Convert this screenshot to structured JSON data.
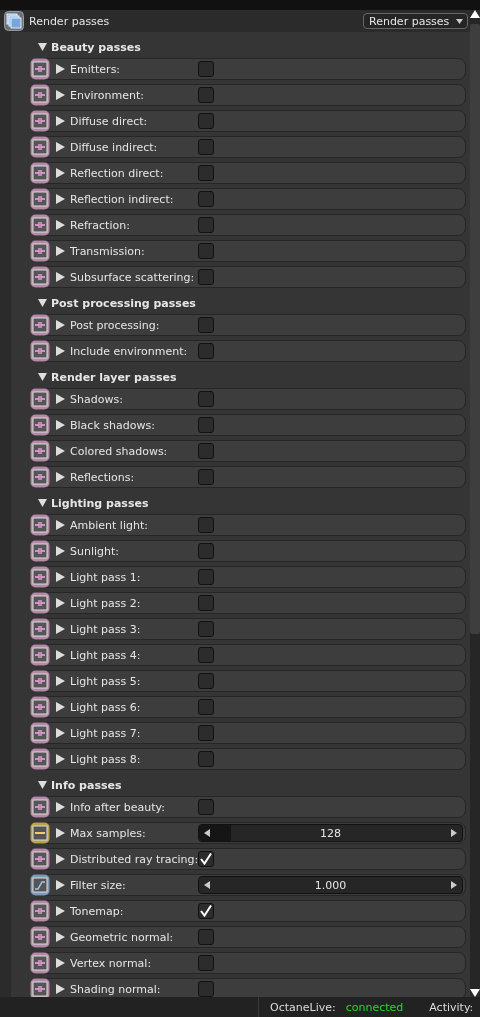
{
  "header": {
    "title": "Render passes",
    "dropdown": "Render passes"
  },
  "sections": [
    {
      "title": "Beauty passes",
      "expanded": true,
      "rows": [
        {
          "kind": "bool",
          "label": "Emitters:",
          "checked": false
        },
        {
          "kind": "bool",
          "label": "Environment:",
          "checked": false
        },
        {
          "kind": "bool",
          "label": "Diffuse direct:",
          "checked": false
        },
        {
          "kind": "bool",
          "label": "Diffuse indirect:",
          "checked": false
        },
        {
          "kind": "bool",
          "label": "Reflection direct:",
          "checked": false
        },
        {
          "kind": "bool",
          "label": "Reflection indirect:",
          "checked": false
        },
        {
          "kind": "bool",
          "label": "Refraction:",
          "checked": false
        },
        {
          "kind": "bool",
          "label": "Transmission:",
          "checked": false
        },
        {
          "kind": "bool",
          "label": "Subsurface scattering:",
          "checked": false
        }
      ]
    },
    {
      "title": "Post processing passes",
      "expanded": true,
      "rows": [
        {
          "kind": "bool",
          "label": "Post processing:",
          "checked": false
        },
        {
          "kind": "bool",
          "label": "Include environment:",
          "checked": false
        }
      ]
    },
    {
      "title": "Render layer passes",
      "expanded": true,
      "rows": [
        {
          "kind": "bool",
          "label": "Shadows:",
          "checked": false
        },
        {
          "kind": "bool",
          "label": "Black shadows:",
          "checked": false
        },
        {
          "kind": "bool",
          "label": "Colored shadows:",
          "checked": false
        },
        {
          "kind": "bool",
          "label": "Reflections:",
          "checked": false
        }
      ]
    },
    {
      "title": "Lighting passes",
      "expanded": true,
      "rows": [
        {
          "kind": "bool",
          "label": "Ambient light:",
          "checked": false
        },
        {
          "kind": "bool",
          "label": "Sunlight:",
          "checked": false
        },
        {
          "kind": "bool",
          "label": "Light pass 1:",
          "checked": false
        },
        {
          "kind": "bool",
          "label": "Light pass 2:",
          "checked": false
        },
        {
          "kind": "bool",
          "label": "Light pass 3:",
          "checked": false
        },
        {
          "kind": "bool",
          "label": "Light pass 4:",
          "checked": false
        },
        {
          "kind": "bool",
          "label": "Light pass 5:",
          "checked": false
        },
        {
          "kind": "bool",
          "label": "Light pass 6:",
          "checked": false
        },
        {
          "kind": "bool",
          "label": "Light pass 7:",
          "checked": false
        },
        {
          "kind": "bool",
          "label": "Light pass 8:",
          "checked": false
        }
      ]
    },
    {
      "title": "Info passes",
      "expanded": true,
      "rows": [
        {
          "kind": "bool",
          "label": "Info after beauty:",
          "checked": false
        },
        {
          "kind": "int",
          "label": "Max samples:",
          "value": "128",
          "level": 0.12
        },
        {
          "kind": "bool",
          "label": "Distributed ray tracing:",
          "checked": true
        },
        {
          "kind": "float",
          "label": "Filter size:",
          "value": "1.000"
        },
        {
          "kind": "bool",
          "label": "Tonemap:",
          "checked": true
        },
        {
          "kind": "bool",
          "label": "Geometric normal:",
          "checked": false
        },
        {
          "kind": "bool",
          "label": "Vertex normal:",
          "checked": false
        },
        {
          "kind": "bool",
          "label": "Shading normal:",
          "checked": false
        }
      ]
    }
  ],
  "status_bar": {
    "label": "OctaneLive:",
    "status": "connected",
    "activity_label": "Activity:"
  }
}
